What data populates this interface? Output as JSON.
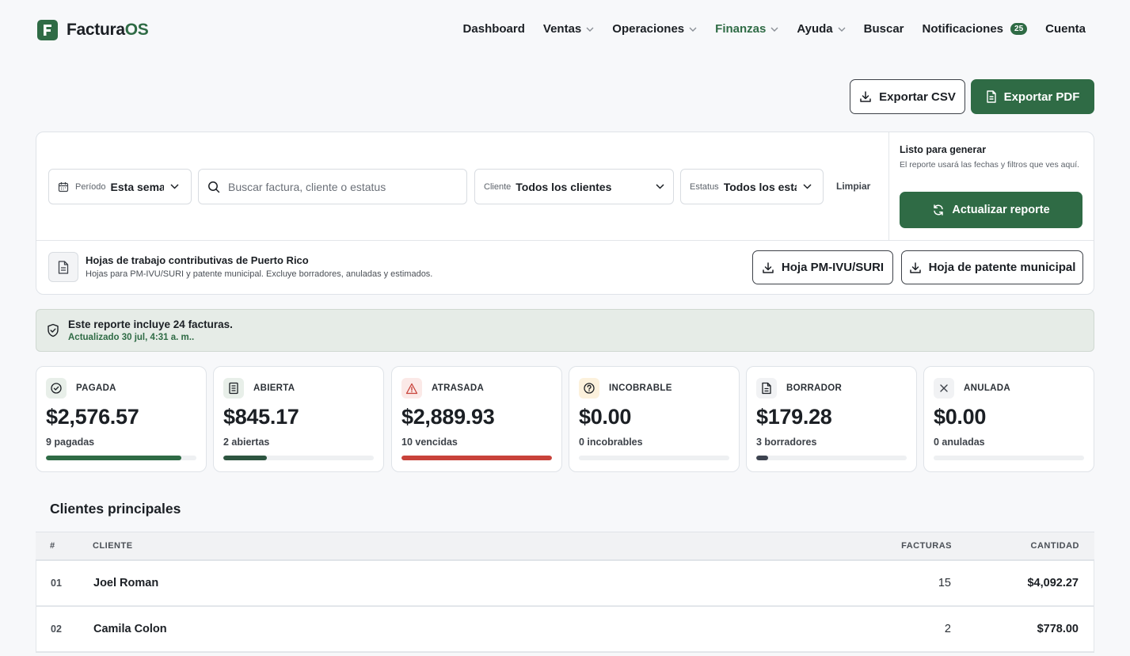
{
  "app": {
    "brand_prefix": "Factura",
    "brand_suffix": "OS"
  },
  "nav": {
    "dashboard": "Dashboard",
    "ventas": "Ventas",
    "operaciones": "Operaciones",
    "finanzas": "Finanzas",
    "ayuda": "Ayuda",
    "buscar": "Buscar",
    "notificaciones": "Notificaciones",
    "notificaciones_count": "25",
    "cuenta": "Cuenta"
  },
  "actions": {
    "export_csv": "Exportar CSV",
    "export_pdf": "Exportar PDF"
  },
  "filters": {
    "periodo_label": "Período",
    "periodo_value": "Esta semana",
    "search_placeholder": "Buscar factura, cliente o estatus",
    "cliente_label": "Cliente",
    "cliente_value": "Todos los clientes",
    "estatus_label": "Estatus",
    "estatus_value": "Todos los estatus",
    "limpiar": "Limpiar"
  },
  "generate": {
    "title": "Listo para generar",
    "description": "El reporte usará las fechas y filtros que ves aquí.",
    "button": "Actualizar reporte"
  },
  "tax": {
    "title": "Hojas de trabajo contributivas de Puerto Rico",
    "description": "Hojas para PM-IVU/SURI y patente municipal. Excluye borradores, anuladas y estimados.",
    "btn_ivu": "Hoja PM-IVU/SURI",
    "btn_patente": "Hoja de patente municipal"
  },
  "banner": {
    "title": "Este reporte incluye 24 facturas.",
    "updated": "Actualizado 30 jul, 4:31 a. m.."
  },
  "colors": {
    "brand": "#2f6b45",
    "danger": "#c8423a",
    "draft": "#3d4350"
  },
  "cards": [
    {
      "label": "PAGADA",
      "amount": "$2,576.57",
      "count": "9 pagadas",
      "icon": "check-circle-icon",
      "progress": 0.9,
      "bar_color": "#2f6b45"
    },
    {
      "label": "ABIERTA",
      "amount": "$845.17",
      "count": "2 abiertas",
      "icon": "document-icon",
      "progress": 0.29,
      "bar_color": "#2d5540"
    },
    {
      "label": "ATRASADA",
      "amount": "$2,889.93",
      "count": "10 vencidas",
      "icon": "warning-icon",
      "progress": 1.0,
      "bar_color": "#c8423a"
    },
    {
      "label": "INCOBRABLE",
      "amount": "$0.00",
      "count": "0 incobrables",
      "icon": "question-circle-icon",
      "progress": 0,
      "bar_color": "#b8862d"
    },
    {
      "label": "BORRADOR",
      "amount": "$179.28",
      "count": "3 borradores",
      "icon": "draft-document-icon",
      "progress": 0.08,
      "bar_color": "#3d4350"
    },
    {
      "label": "ANULADA",
      "amount": "$0.00",
      "count": "0 anuladas",
      "icon": "close-icon",
      "progress": 0,
      "bar_color": "#8a8f96"
    }
  ],
  "top_clients": {
    "title": "Clientes principales",
    "columns": {
      "num": "#",
      "client": "CLIENTE",
      "invoices": "FACTURAS",
      "amount": "CANTIDAD"
    },
    "rows": [
      {
        "num": "01",
        "client": "Joel Roman",
        "invoices": "15",
        "amount": "$4,092.27"
      },
      {
        "num": "02",
        "client": "Camila Colon",
        "invoices": "2",
        "amount": "$778.00"
      }
    ]
  }
}
